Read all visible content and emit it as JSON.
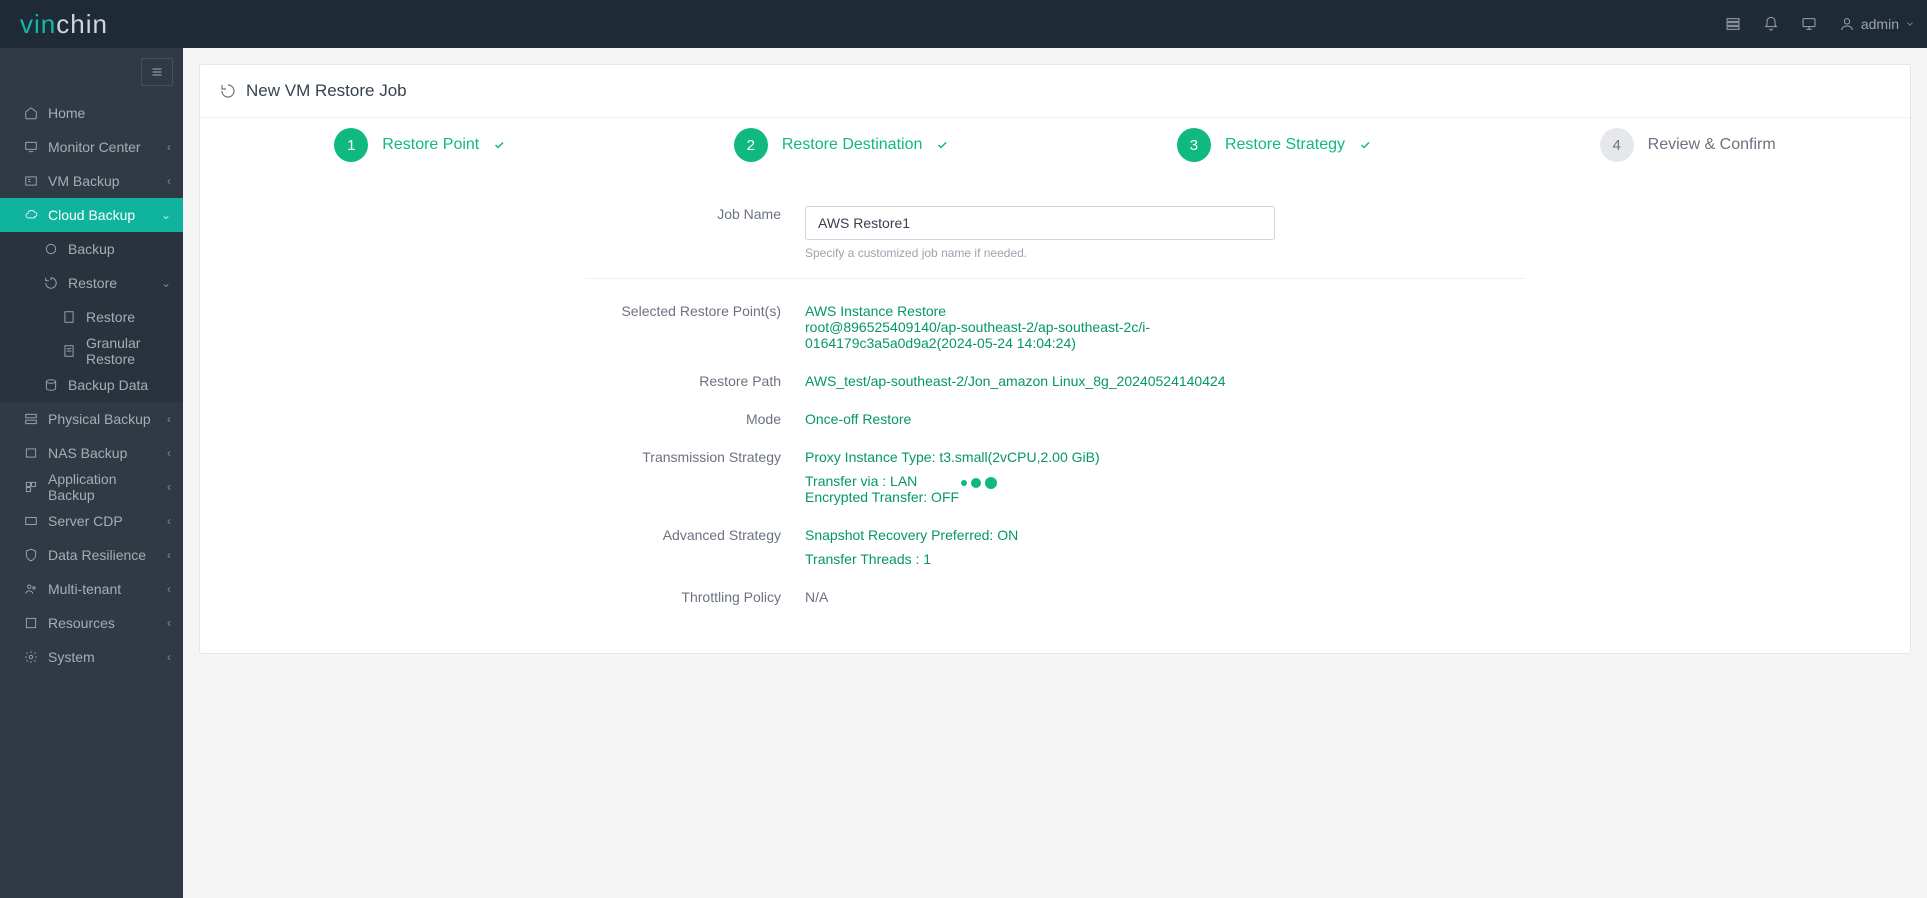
{
  "brand": {
    "part1": "vin",
    "part2": "chin"
  },
  "topbar": {
    "user": "admin"
  },
  "sidebar": {
    "items": [
      {
        "label": "Home"
      },
      {
        "label": "Monitor Center"
      },
      {
        "label": "VM Backup"
      },
      {
        "label": "Cloud Backup"
      },
      {
        "label": "Physical Backup"
      },
      {
        "label": "NAS Backup"
      },
      {
        "label": "Application Backup"
      },
      {
        "label": "Server CDP"
      },
      {
        "label": "Data Resilience"
      },
      {
        "label": "Multi-tenant"
      },
      {
        "label": "Resources"
      },
      {
        "label": "System"
      }
    ],
    "cloud_sub": [
      {
        "label": "Backup"
      },
      {
        "label": "Restore"
      },
      {
        "label": "Backup Data"
      }
    ],
    "restore_sub": [
      {
        "label": "Restore"
      },
      {
        "label": "Granular Restore"
      }
    ]
  },
  "page": {
    "title": "New VM Restore Job",
    "steps": [
      {
        "num": "1",
        "label": "Restore Point"
      },
      {
        "num": "2",
        "label": "Restore Destination"
      },
      {
        "num": "3",
        "label": "Restore Strategy"
      },
      {
        "num": "4",
        "label": "Review & Confirm"
      }
    ],
    "form": {
      "job_name_label": "Job Name",
      "job_name_value": "AWS Restore1",
      "job_name_help": "Specify a customized job name if needed.",
      "restore_points_label": "Selected Restore Point(s)",
      "restore_points_title": "AWS Instance Restore",
      "restore_points_detail": "root@896525409140/ap-southeast-2/ap-southeast-2c/i-0164179c3a5a0d9a2(2024-05-24 14:04:24)",
      "restore_path_label": "Restore Path",
      "restore_path_value": "AWS_test/ap-southeast-2/Jon_amazon Linux_8g_20240524140424",
      "mode_label": "Mode",
      "mode_value": "Once-off Restore",
      "trans_label": "Transmission Strategy",
      "trans_proxy": "Proxy Instance Type: t3.small(2vCPU,2.00 GiB)",
      "trans_via": "Transfer via : LAN",
      "trans_enc": "Encrypted Transfer: OFF",
      "adv_label": "Advanced Strategy",
      "adv_snap": "Snapshot Recovery Preferred: ON",
      "adv_threads": "Transfer Threads : 1",
      "throt_label": "Throttling Policy",
      "throt_value": "N/A"
    }
  }
}
